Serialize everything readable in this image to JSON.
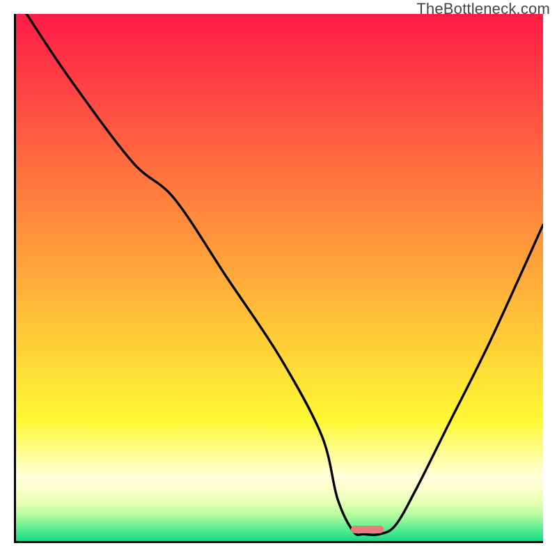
{
  "watermark": "TheBottleneck.com",
  "colors": {
    "axis": "#000000",
    "curve": "#000000",
    "marker": "#e77b7e"
  },
  "background_bands": [
    {
      "top_pct": 0.0,
      "height_pct": 77.0,
      "color_top": "#ff1a47",
      "color_bottom": "#fff833"
    },
    {
      "top_pct": 77.0,
      "height_pct": 9.0,
      "color_top": "#fff833",
      "color_bottom": "#ffffbb"
    },
    {
      "top_pct": 86.0,
      "height_pct": 2.0,
      "color_top": "#ffffbb",
      "color_bottom": "#ffffdc"
    },
    {
      "top_pct": 88.0,
      "height_pct": 2.5,
      "color_top": "#ffffdc",
      "color_bottom": "#f8ffc8"
    },
    {
      "top_pct": 90.5,
      "height_pct": 2.5,
      "color_top": "#f8ffc8",
      "color_bottom": "#e2ffb2"
    },
    {
      "top_pct": 93.0,
      "height_pct": 2.5,
      "color_top": "#e2ffb2",
      "color_bottom": "#a8fa9a"
    },
    {
      "top_pct": 95.5,
      "height_pct": 2.5,
      "color_top": "#a8fa9a",
      "color_bottom": "#4feb8f"
    },
    {
      "top_pct": 98.0,
      "height_pct": 2.0,
      "color_top": "#4feb8f",
      "color_bottom": "#16dc85"
    }
  ],
  "marker": {
    "x_pct": 63.5,
    "width_pct": 6.2,
    "y_from_bottom_pct": 1.4
  },
  "chart_data": {
    "type": "line",
    "title": "",
    "xlabel": "",
    "ylabel": "",
    "xlim": [
      0,
      100
    ],
    "ylim": [
      0,
      100
    ],
    "series": [
      {
        "name": "curve",
        "x": [
          2,
          10,
          22,
          30,
          40,
          50,
          58,
          61,
          64,
          66,
          69,
          72,
          76,
          82,
          90,
          100
        ],
        "y": [
          100,
          88,
          72,
          65,
          50,
          35,
          20,
          8,
          1.8,
          1.3,
          1.3,
          3,
          10,
          22,
          38,
          60
        ]
      }
    ],
    "optimum_band": {
      "x_start": 63.5,
      "x_end": 69.7,
      "y": 1.4
    }
  }
}
